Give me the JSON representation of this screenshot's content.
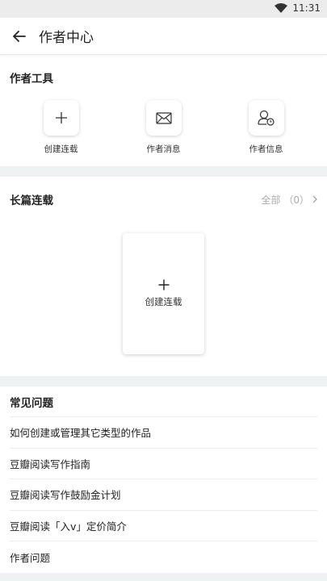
{
  "status_bar": {
    "time": "11:31"
  },
  "appbar": {
    "title": "作者中心"
  },
  "tools": {
    "title": "作者工具",
    "items": [
      {
        "label": "创建连载",
        "icon": "plus-icon"
      },
      {
        "label": "作者消息",
        "icon": "envelope-icon"
      },
      {
        "label": "作者信息",
        "icon": "user-clock-icon"
      }
    ]
  },
  "serial": {
    "title": "长篇连载",
    "all_label": "全部",
    "count": "（0）",
    "create_label": "创建连载"
  },
  "faq": {
    "title": "常见问题",
    "items": [
      "如何创建或管理其它类型的作品",
      "豆瓣阅读写作指南",
      "豆瓣阅读写作鼓励金计划",
      "豆瓣阅读「入v」定价简介",
      "作者问题"
    ]
  }
}
